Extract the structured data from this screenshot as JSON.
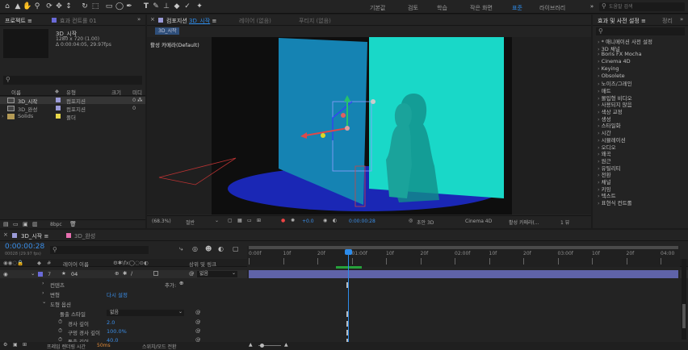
{
  "toolbar": {
    "workspaces": [
      "기본값",
      "검토",
      "학습",
      "작은 화면",
      "표준",
      "라이브러리"
    ],
    "active_workspace": "표준",
    "search_placeholder": "도움말 검색"
  },
  "project": {
    "tab_label": "프로젝트",
    "tab_menu": "≡",
    "effect_controls_tab": "효과 컨트롤 01",
    "selected": {
      "name": "3D_시작",
      "size": "1280 x 720 (1.00)",
      "duration": "Δ 0:00:04:05, 29.97fps"
    },
    "search_placeholder": "",
    "columns": {
      "name": "이름",
      "type": "유형",
      "size": "크기",
      "media": "미디"
    },
    "items": [
      {
        "name": "3D_시작",
        "type": "컴포지션",
        "size": "0",
        "color": "#9b9bd8"
      },
      {
        "name": "3D_완성",
        "type": "컴포지션",
        "size": "0",
        "color": "#9b9bd8"
      },
      {
        "name": "Solids",
        "type": "폴더",
        "size": "",
        "color": "#e8d84a"
      }
    ],
    "bpc": "8bpc"
  },
  "composition": {
    "tab_label": "컴포지션",
    "tab_name": "3D_시작",
    "tab_menu": "≡",
    "layer_tab": "레이어 (없음)",
    "footage_tab": "푸티지 (없음)",
    "breadcrumb": "3D_시작",
    "camera_label": "활성 카메라(Default)",
    "footer": {
      "zoom": "(68.3%)",
      "fit": "절반",
      "exposure": "+0.0",
      "timecode": "0:00:00:28",
      "renderer_label": "초안 3D",
      "renderer": "Cinema 4D",
      "view": "활성 카메라(...",
      "views_count": "1 뷰"
    }
  },
  "effects_panel": {
    "title": "효과 및 사전 설정",
    "tab_menu": "≡",
    "other_tab": "정리",
    "search_placeholder": "",
    "items": [
      "* 애니메이션 사전 설정",
      "3D 채널",
      "Boris FX Mocha",
      "Cinema 4D",
      "Keying",
      "Obsolete",
      "노이즈/그레인",
      "매트",
      "몰입형 비디오",
      "사용되지 않음",
      "색상 교정",
      "생성",
      "스타일화",
      "시간",
      "시뮬레이션",
      "오디오",
      "왜곡",
      "원근",
      "유틸리티",
      "전환",
      "채널",
      "키잉",
      "텍스트",
      "표현식 컨트롤"
    ]
  },
  "timeline": {
    "tabs": [
      {
        "label": "3D_시작",
        "menu": "≡",
        "color": "#9b9bd8"
      },
      {
        "label": "3D_완성",
        "menu": "",
        "color": "#e86fb0"
      }
    ],
    "current_time": "0:00:00:28",
    "frame_info": "00028 (29.97 fps)",
    "search_placeholder": "",
    "columns": {
      "layer_name": "레이어 이름",
      "parent": "상위 및 링크"
    },
    "layer": {
      "index": "7",
      "name": "04",
      "parent": "없음",
      "color": "#6a6ad8"
    },
    "properties": [
      {
        "label": "컨텐츠",
        "value": "추가:"
      },
      {
        "label": "변형",
        "value": "다시 설정"
      },
      {
        "label": "도형 옵션",
        "value": ""
      },
      {
        "label": "돌출 스타일",
        "value": "없음"
      },
      {
        "label": "경사 깊이",
        "value": "2.0"
      },
      {
        "label": "구멍 경사 깊이",
        "value": "100.0%"
      },
      {
        "label": "돌출 깊이",
        "value": "40.0"
      }
    ],
    "ruler": [
      "0:00f",
      "10f",
      "20f",
      "01:00f",
      "10f",
      "20f",
      "02:00f",
      "10f",
      "20f",
      "03:00f",
      "10f",
      "20f",
      "04:00"
    ],
    "footer": {
      "render_time_label": "프레임 렌더링 시간",
      "render_time": "50ms",
      "toggle": "스위치/모드 전환"
    }
  }
}
